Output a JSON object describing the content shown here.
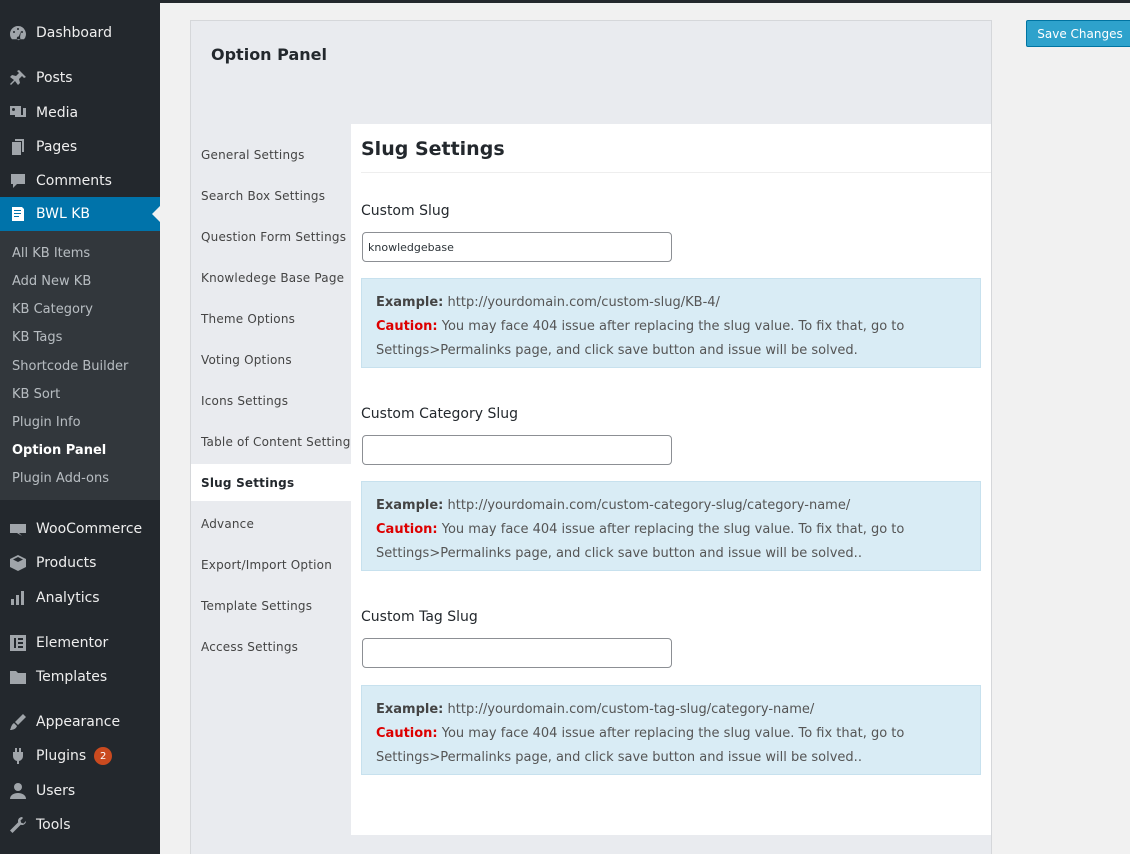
{
  "sidebar": {
    "menu_top": [
      {
        "label": "Dashboard",
        "icon": "dashboard-icon"
      },
      {
        "label": "Posts",
        "icon": "pin-icon"
      },
      {
        "label": "Media",
        "icon": "media-icon"
      },
      {
        "label": "Pages",
        "icon": "pages-icon"
      },
      {
        "label": "Comments",
        "icon": "comments-icon"
      },
      {
        "label": "BWL KB",
        "icon": "book-icon"
      }
    ],
    "submenu": [
      {
        "label": "All KB Items"
      },
      {
        "label": "Add New KB"
      },
      {
        "label": "KB Category"
      },
      {
        "label": "KB Tags"
      },
      {
        "label": "Shortcode Builder"
      },
      {
        "label": "KB Sort"
      },
      {
        "label": "Plugin Info"
      },
      {
        "label": "Option Panel"
      },
      {
        "label": "Plugin Add-ons"
      }
    ],
    "menu_bottom": [
      {
        "label": "WooCommerce",
        "icon": "woocommerce-icon"
      },
      {
        "label": "Products",
        "icon": "box-icon"
      },
      {
        "label": "Analytics",
        "icon": "bar-chart-icon"
      },
      {
        "label": "Elementor",
        "icon": "elementor-icon"
      },
      {
        "label": "Templates",
        "icon": "folder-icon"
      },
      {
        "label": "Appearance",
        "icon": "brush-icon"
      },
      {
        "label": "Plugins",
        "icon": "plug-icon",
        "badge": "2"
      },
      {
        "label": "Users",
        "icon": "user-icon"
      },
      {
        "label": "Tools",
        "icon": "wrench-icon"
      }
    ]
  },
  "panel": {
    "title": "Option Panel",
    "save_label": "Save Changes",
    "tabs": [
      {
        "label": "General Settings"
      },
      {
        "label": "Search Box Settings"
      },
      {
        "label": "Question Form Settings"
      },
      {
        "label": "Knowledege Base Page"
      },
      {
        "label": "Theme Options"
      },
      {
        "label": "Voting Options"
      },
      {
        "label": "Icons Settings"
      },
      {
        "label": "Table of Content Settings"
      },
      {
        "label": "Slug Settings"
      },
      {
        "label": "Advance"
      },
      {
        "label": "Export/Import Option"
      },
      {
        "label": "Template Settings"
      },
      {
        "label": "Access Settings"
      }
    ],
    "active_tab": "Slug Settings"
  },
  "content": {
    "title": "Slug Settings",
    "fields": [
      {
        "label": "Custom Slug",
        "value": "knowledgebase",
        "example_label": "Example:",
        "example": "http://yourdomain.com/custom-slug/KB-4/",
        "caution_label": "Caution:",
        "caution": "You may face 404 issue after replacing the slug value. To fix that, go to Settings>Permalinks page, and click save button and issue will be solved."
      },
      {
        "label": "Custom Category Slug",
        "value": "",
        "example_label": "Example:",
        "example": "http://yourdomain.com/custom-category-slug/category-name/",
        "caution_label": "Caution:",
        "caution": "You may face 404 issue after replacing the slug value. To fix that, go to Settings>Permalinks page, and click save button and issue will be solved.."
      },
      {
        "label": "Custom Tag Slug",
        "value": "",
        "example_label": "Example:",
        "example": "http://yourdomain.com/custom-tag-slug/category-name/",
        "caution_label": "Caution:",
        "caution": "You may face 404 issue after replacing the slug value. To fix that, go to Settings>Permalinks page, and click save button and issue will be solved.."
      }
    ]
  },
  "colors": {
    "sidebar_bg": "#23282d",
    "submenu_bg": "#32373c",
    "accent": "#0073aa",
    "note_bg": "#d9ecf5",
    "caution": "#dd0000",
    "button": "#2ea2cc"
  }
}
